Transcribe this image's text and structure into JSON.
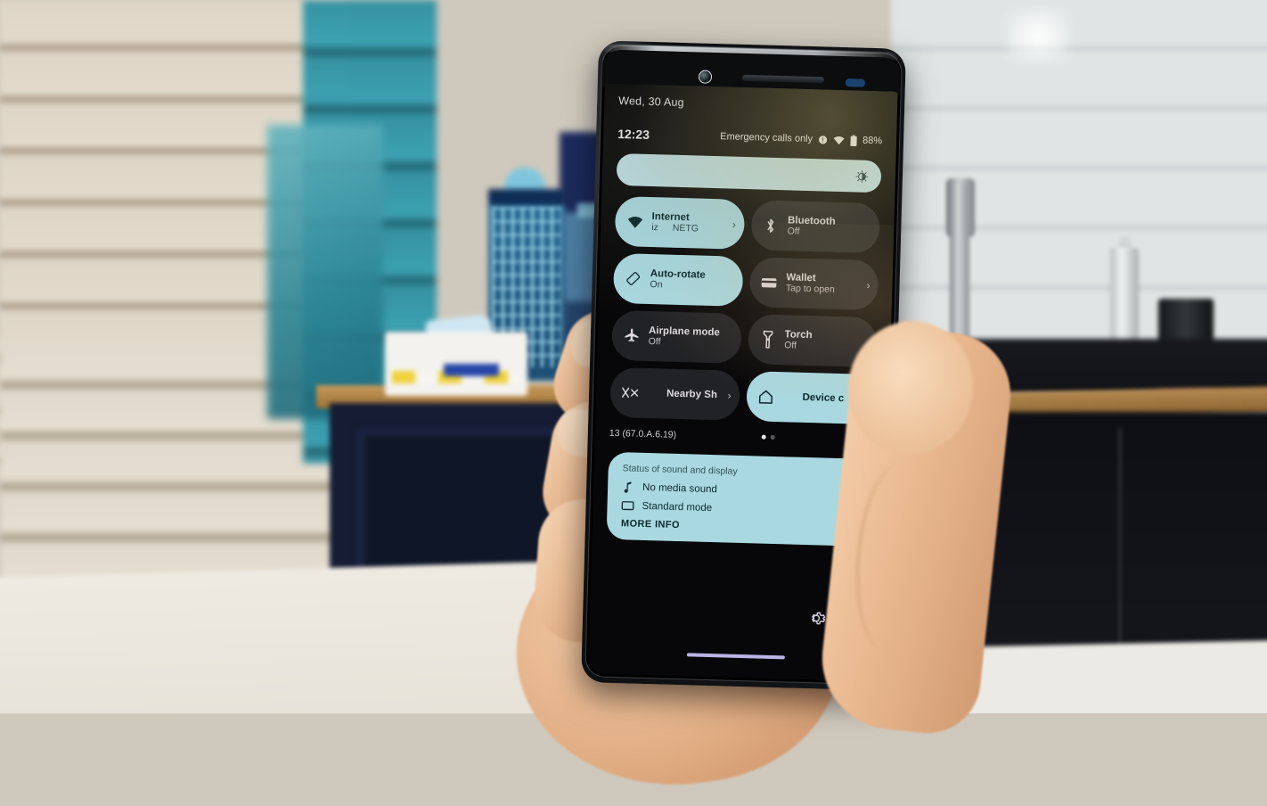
{
  "scene": {
    "description": "hand holding a smartphone showing the Android quick settings panel in a kitchen"
  },
  "phone": {
    "hardware": {
      "front_camera": "front-camera",
      "earpiece": "earpiece-speaker",
      "sensor": "proximity-sensor"
    }
  },
  "status_bar": {
    "date": "Wed, 30 Aug",
    "clock": "12:23",
    "carrier": "Emergency calls only",
    "icons": [
      "no-sim-icon",
      "wifi-icon",
      "battery-icon"
    ],
    "battery": "88%"
  },
  "brightness": {
    "name": "brightness-slider",
    "icon": "brightness-icon",
    "level": 100
  },
  "tiles": [
    {
      "id": "internet",
      "title": "Internet",
      "sub": "NETG",
      "sub_left": "iz",
      "icon": "wifi-icon",
      "state": "on",
      "chevron": "›"
    },
    {
      "id": "bluetooth",
      "title": "Bluetooth",
      "sub": "Off",
      "icon": "bluetooth-icon",
      "state": "off",
      "chevron": ""
    },
    {
      "id": "auto-rotate",
      "title": "Auto-rotate",
      "sub": "On",
      "icon": "auto-rotate-icon",
      "state": "on",
      "chevron": ""
    },
    {
      "id": "wallet",
      "title": "Wallet",
      "sub": "Tap to open",
      "icon": "wallet-icon",
      "state": "off",
      "chevron": "›"
    },
    {
      "id": "airplane-mode",
      "title": "Airplane mode",
      "sub": "Off",
      "icon": "airplane-icon",
      "state": "off",
      "chevron": ""
    },
    {
      "id": "torch",
      "title": "Torch",
      "sub": "Off",
      "icon": "torch-icon",
      "state": "off",
      "chevron": ""
    },
    {
      "id": "nearby-share",
      "title": "Nearby Sh",
      "sub": "",
      "icon": "nearby-share-icon",
      "state": "off",
      "chevron": "›"
    },
    {
      "id": "device-controls",
      "title": "Device c",
      "sub": "",
      "icon": "home-icon",
      "state": "on",
      "chevron": "›"
    }
  ],
  "footer": {
    "build": "13 (67.0.A.6.19)",
    "edit_icon": "pencil-edit-icon",
    "pages": 2,
    "active_page": 1
  },
  "sound_display_card": {
    "title": "Status of sound and display",
    "rows": [
      {
        "icon": "music-note-icon",
        "label": "No media sound",
        "gear": "gear-icon"
      },
      {
        "icon": "display-icon",
        "label": "Standard mode",
        "gear": "gear-icon"
      }
    ],
    "more_info": "MORE INFO"
  },
  "bottom_bar": {
    "settings_icon": "gear-icon",
    "power_button": "power-button",
    "nav_handle": "gesture-nav-handle"
  },
  "colors": {
    "accent_on": "#a9d8e0",
    "tile_off": "#212226",
    "screen_bg": "#070709",
    "nav_handle": "#b9b5e6"
  }
}
